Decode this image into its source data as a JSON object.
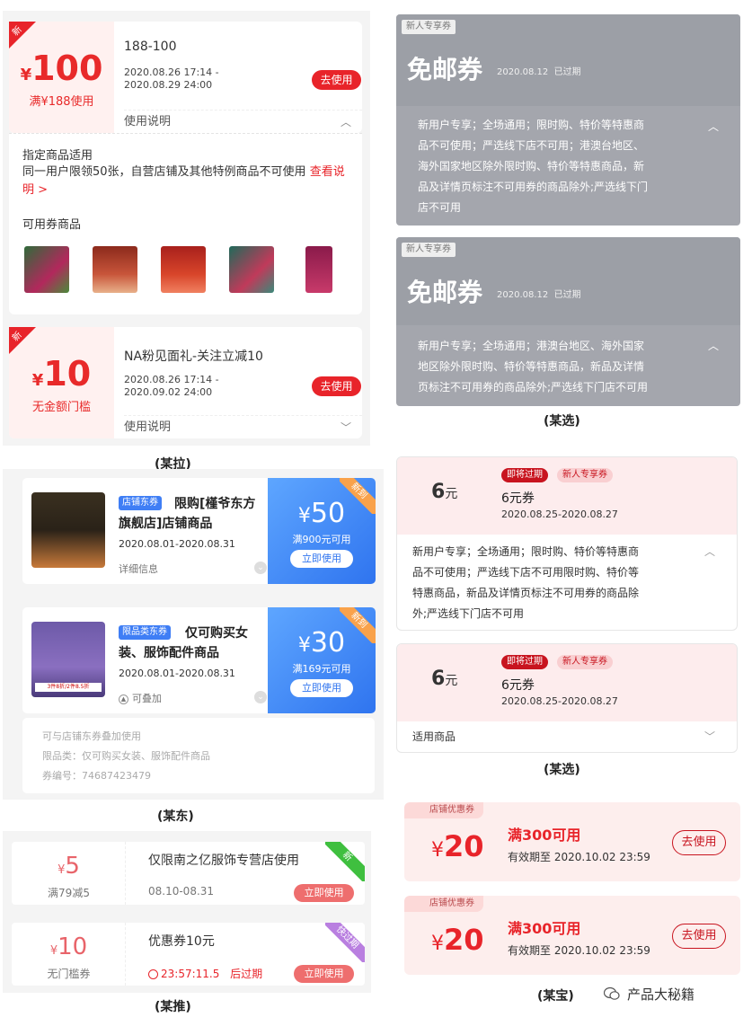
{
  "kaola": {
    "caption": "(某拉)",
    "new_tag": "新",
    "coupons": [
      {
        "currency": "¥",
        "amount": "100",
        "condition": "满¥188使用",
        "title": "188-100",
        "date": "2020.08.26 17:14 - 2020.08.29 24:00",
        "button": "去使用",
        "usage": "使用说明"
      },
      {
        "currency": "¥",
        "amount": "10",
        "condition": "无金额门槛",
        "title": "NA粉见面礼-关注立减10",
        "date": "2020.08.26 17:14 - 2020.09.02 24:00",
        "button": "去使用",
        "usage": "使用说明"
      }
    ],
    "detail": {
      "line1": "指定商品适用",
      "line2": "同一用户限领50张，自营店铺及其他特例商品不可使用",
      "link": "查看说明 >",
      "goods_label": "可用券商品"
    }
  },
  "jd": {
    "caption": "(某东)",
    "coupons": [
      {
        "tag": "店铺东券",
        "title": "限购[槿爷东方旗舰店]店铺商品",
        "date": "2020.08.01-2020.08.31",
        "info": "详细信息",
        "currency": "¥",
        "amount": "50",
        "condition": "满900元可用",
        "button": "立即使用",
        "ribbon": "新到"
      },
      {
        "tag": "限品类东券",
        "title": "仅可购买女装、服饰配件商品",
        "date": "2020.08.01-2020.08.31",
        "info": "可叠加",
        "currency": "¥",
        "amount": "30",
        "condition": "满169元可用",
        "button": "立即使用",
        "ribbon": "新到",
        "img_text": "3件8折/2件8.5折"
      }
    ],
    "extra": {
      "line1": "可与店铺东券叠加使用",
      "line2": "限品类：仅可购买女装、服饰配件商品",
      "line3": "券编号：74687423479"
    }
  },
  "mogu": {
    "caption": "(某推)",
    "coupons": [
      {
        "currency": "¥",
        "amount": "5",
        "condition": "满79减5",
        "title": "仅限南之亿服饰专营店使用",
        "date": "08.10-08.31",
        "button": "立即使用",
        "corner": "新",
        "corner_color": "#3fbf3f"
      },
      {
        "currency": "¥",
        "amount": "10",
        "condition": "无门槛券",
        "title": "优惠券10元",
        "countdown": "23:57:11.5",
        "countdown_suffix": "后过期",
        "button": "立即使用",
        "corner": "快过期",
        "corner_color": "#b97fe0"
      }
    ]
  },
  "yanxuan_gray": {
    "caption": "(某选)",
    "coupons": [
      {
        "tag": "新人专享券",
        "title": "免邮券",
        "date": "2020.08.12",
        "status": "已过期",
        "desc": [
          "新用户专享；全场通用；限时购、特价等特惠商",
          "品不可使用；严选线下店不可用；港澳台地区、",
          "海外国家地区除外限时购、特价等特惠商品，新",
          "品及详情页标注不可用券的商品除外;严选线下门",
          "店不可用"
        ]
      },
      {
        "tag": "新人专享券",
        "title": "免邮券",
        "date": "2020.08.12",
        "status": "已过期",
        "desc": [
          "新用户专享；全场通用；港澳台地区、海外国家",
          "地区除外限时购、特价等特惠商品，新品及详情",
          "页标注不可用券的商品除外;严选线下门店不可用"
        ]
      }
    ]
  },
  "yanxuan_red": {
    "caption": "(某选)",
    "coupons": [
      {
        "amount": "6",
        "unit": "元",
        "badge1": "即将过期",
        "badge2": "新人专享券",
        "name": "6元券",
        "range": "2020.08.25-2020.08.27",
        "desc": [
          "新用户专享；全场通用；限时购、特价等特惠商",
          "品不可使用；严选线下店不可用限时购、特价等",
          "特惠商品，新品及详情页标注不可用券的商品除",
          "外;严选线下门店不可用"
        ]
      },
      {
        "amount": "6",
        "unit": "元",
        "badge1": "即将过期",
        "badge2": "新人专享券",
        "name": "6元券",
        "range": "2020.08.25-2020.08.27",
        "applicable": "适用商品"
      }
    ]
  },
  "taobao": {
    "caption": "(某宝)",
    "coupons": [
      {
        "tag": "店铺优惠券",
        "currency": "¥",
        "amount": "20",
        "condition": "满300可用",
        "expiry": "有效期至 2020.10.02 23:59",
        "button": "去使用"
      },
      {
        "tag": "店铺优惠券",
        "currency": "¥",
        "amount": "20",
        "condition": "满300可用",
        "expiry": "有效期至 2020.10.02 23:59",
        "button": "去使用"
      }
    ]
  },
  "watermark": "产品大秘籍",
  "colors": {
    "kaola_red": "#e8242a",
    "jd_blue": "#2f74ef",
    "yanxuan_gray": "#a4a6ad",
    "taobao_red": "#e8242a"
  },
  "icons": [
    "chevron-up-icon",
    "chevron-down-icon",
    "clock-icon",
    "stack-icon",
    "wechat-icon"
  ]
}
